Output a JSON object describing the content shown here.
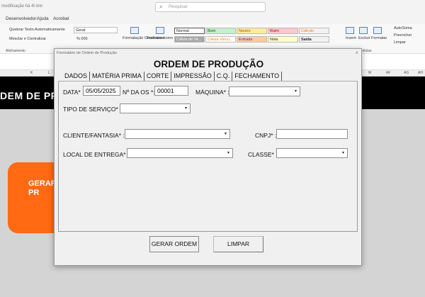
{
  "excel": {
    "doc_name": "modificação há 4l min",
    "search_placeholder": "Pesquisar",
    "menu": [
      "Desenvolvedor",
      "Ajuda",
      "Acrobat"
    ],
    "ribbon": {
      "wrap_text": "Quebrar Texto Automaticamente",
      "merge": "Mesclar e Centralizar",
      "number_format": "Geral",
      "number_symbols": "% 000",
      "cond_format": "Formatação Condicional",
      "format_table": "Formatar como Tabela",
      "styles": [
        "Normal",
        "Bom",
        "Neutro",
        "Ruim",
        "Cálculo",
        "Célula de Ve...",
        "Célula Vincu...",
        "Entrada",
        "Nota",
        "Saída"
      ],
      "insert": "Inserir",
      "delete": "Excluir",
      "format": "Formatar",
      "autosum": "AutoSoma",
      "fill": "Preencher",
      "clear": "Limpar",
      "group_alignment": "Alinhamento",
      "group_cells": "Células"
    },
    "columns": [
      "K",
      "L",
      "M",
      "AF",
      "AG",
      "AH"
    ],
    "sheet_title": "DEM DE PR",
    "orange_button": "GERAR\nPR"
  },
  "dialog": {
    "caption": "Formulário de Ordem de Produção",
    "close": "×",
    "heading": "ORDEM DE PRODUÇÃO",
    "tabs": [
      "DADOS",
      "MATÉRIA PRIMA",
      "CORTE",
      "IMPRESSÃO",
      "C.Q.",
      "FECHAMENTO"
    ],
    "fields": {
      "data_label": "DATA* :",
      "data_value": "05/05/2025",
      "nos_label": "Nº DA OS *:",
      "nos_value": "00001",
      "maquina_label": "MÁQUINA* :",
      "maquina_value": "",
      "tipo_label": "TIPO DE SERVIÇO* :",
      "tipo_value": "",
      "cliente_label": "CLIENTE/FANTASIA* :",
      "cliente_value": "",
      "cnpj_label": "CNPJ* :",
      "cnpj_value": "",
      "local_label": "LOCAL DE ENTREGA* :",
      "local_value": "",
      "classe_label": "CLASSE* :",
      "classe_value": ""
    },
    "buttons": {
      "generate": "GERAR ORDEM",
      "clear": "LIMPAR"
    }
  },
  "icons": {
    "dropdown": "▾",
    "search": "⌕"
  }
}
